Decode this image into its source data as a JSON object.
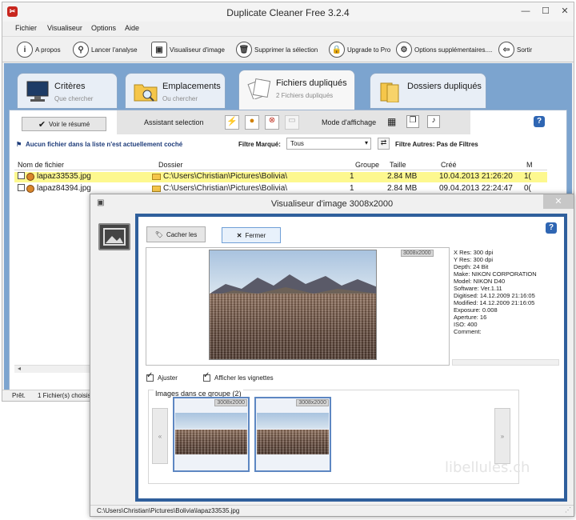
{
  "main_window": {
    "title": "Duplicate Cleaner Free 3.2.4",
    "menu": [
      "Fichier",
      "Visualiseur",
      "Options",
      "Aide"
    ],
    "toolbar": [
      {
        "label": "A propos",
        "icon": "info-icon"
      },
      {
        "label": "Lancer l'analyse",
        "icon": "search-icon"
      },
      {
        "label": "Visualiseur d'image",
        "icon": "image-icon"
      },
      {
        "label": "Supprimer la sélection",
        "icon": "trash-icon"
      },
      {
        "label": "Upgrade to Pro",
        "icon": "lock-icon"
      },
      {
        "label": "Options supplémentaires....",
        "icon": "gear-icon"
      },
      {
        "label": "Sortir",
        "icon": "exit-icon"
      }
    ],
    "tabs": [
      {
        "label": "Critères",
        "sub": "Que chercher",
        "icon": "monitor-icon"
      },
      {
        "label": "Emplacements",
        "sub": "Ou chercher",
        "icon": "folder-search-icon"
      },
      {
        "label": "Fichiers dupliqués",
        "sub": "2 Fichiers dupliqués",
        "icon": "files-icon"
      },
      {
        "label": "Dossiers dupliqués",
        "sub": "",
        "icon": "folders-icon"
      }
    ],
    "panel": {
      "summary_button": "Voir le résumé",
      "assistant_label": "Assistant selection",
      "display_mode_label": "Mode d'affichage",
      "notice": "Aucun fichier dans la liste n'est actuellement coché",
      "filter_marked_label": "Filtre Marqué:",
      "filter_marked_value": "Tous",
      "filter_other": "Filtre Autres: Pas de Filtres",
      "columns": [
        "Nom de fichier",
        "Dossier",
        "Groupe",
        "Taille",
        "Créé",
        "M"
      ],
      "rows": [
        {
          "name": "lapaz33535.jpg",
          "folder": "C:\\Users\\Christian\\Pictures\\Bolivia\\",
          "group": "1",
          "size": "2.84 MB",
          "created": "10.04.2013 21:26:20",
          "m": "1(",
          "highlight": true
        },
        {
          "name": "lapaz84394.jpg",
          "folder": "C:\\Users\\Christian\\Pictures\\Bolivia\\",
          "group": "1",
          "size": "2.84 MB",
          "created": "09.04.2013 22:24:47",
          "m": "0(",
          "highlight": false
        }
      ]
    },
    "status": {
      "ready": "Prêt.",
      "selected": "1 Fichier(s) choisis"
    },
    "colors": {
      "highlight_row": "#fdf88f",
      "tab_bg": "#7ca4cf"
    }
  },
  "viewer_window": {
    "title": "Visualiseur d'image 3008x2000",
    "hide_button": "Cacher les",
    "close_button": "Fermer",
    "image_size_badge": "3008x2000",
    "exif": [
      "X Res: 300 dpi",
      "Y Res: 300 dpi",
      "Depth: 24 Bit",
      "Make: NIKON CORPORATION",
      "Model: NIKON D40",
      "Software: Ver.1.11",
      "Digitised: 14.12.2009 21:16:05",
      "Modified: 14.12.2009 21:16:05",
      "Exposure: 0.008",
      "Aperture: 16",
      "ISO: 400",
      "Comment:"
    ],
    "fit_label": "Ajuster",
    "thumbs_label": "Afficher les vignettes",
    "group_label": "Images dans ce groupe (2)",
    "thumbs": [
      {
        "badge": "3008x2000"
      },
      {
        "badge": "3008x2000"
      }
    ],
    "status_path": "C:\\Users\\Christian\\Pictures\\Bolivia\\lapaz33535.jpg",
    "watermark": "libellules.ch"
  }
}
